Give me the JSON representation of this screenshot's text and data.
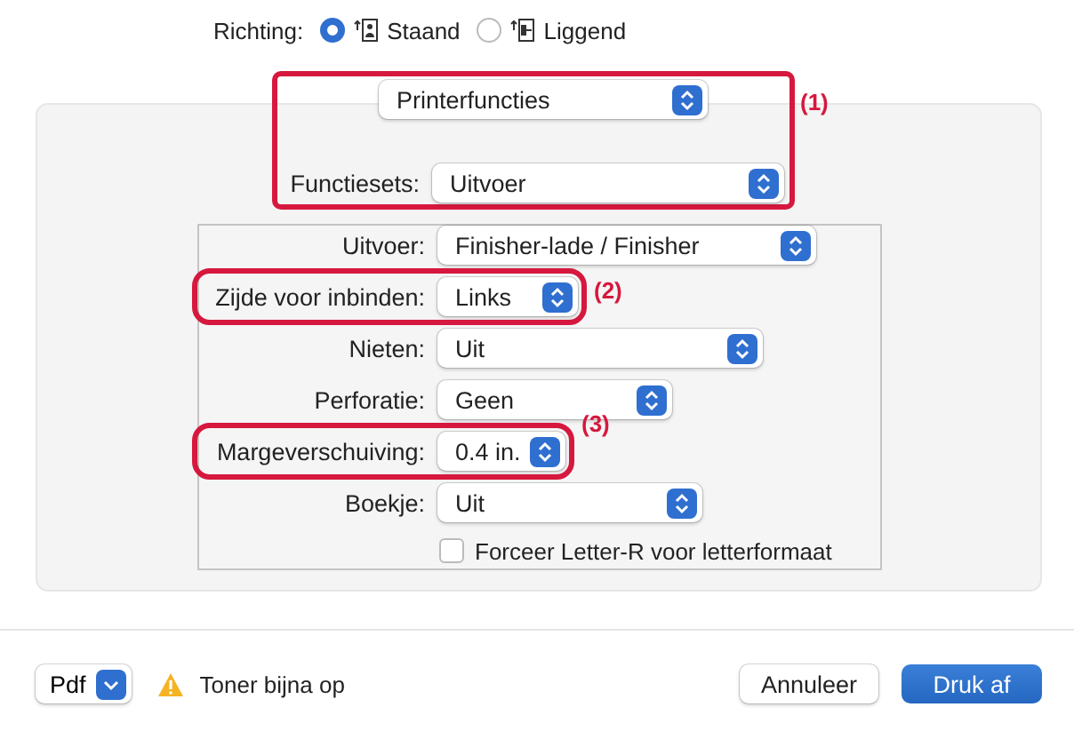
{
  "orientation": {
    "label": "Richting:",
    "options": [
      {
        "label": "Staand",
        "kind": "portrait",
        "selected": true
      },
      {
        "label": "Liggend",
        "kind": "landscape",
        "selected": false
      }
    ]
  },
  "panel_menu": {
    "value": "Printerfuncties"
  },
  "feature_sets": {
    "label": "Functiesets:",
    "value": "Uitvoer"
  },
  "group_callout": "(1)",
  "settings": [
    {
      "label": "Uitvoer:",
      "value": "Finisher-lade / Finisher"
    },
    {
      "label": "Zijde voor inbinden:",
      "value": "Links",
      "callout": "(2)"
    },
    {
      "label": "Nieten:",
      "value": "Uit"
    },
    {
      "label": "Perforatie:",
      "value": "Geen"
    },
    {
      "label": "Margeverschuiving:",
      "value": "0.4 in.",
      "callout": "(3)"
    },
    {
      "label": "Boekje:",
      "value": "Uit"
    }
  ],
  "checkbox": {
    "label": "Forceer Letter-R voor letterformaat",
    "checked": false
  },
  "footer": {
    "pdf": "Pdf",
    "warning": "Toner bijna op",
    "buttons": [
      {
        "label": "Annuleer",
        "kind": "secondary"
      },
      {
        "label": "Druk af",
        "kind": "primary"
      }
    ]
  }
}
